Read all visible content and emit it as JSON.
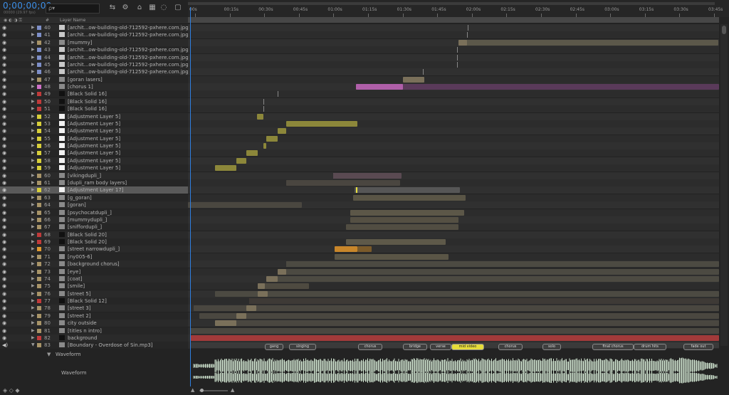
{
  "timecode": "0;00;00;00",
  "fps_label": "00000 (29.97 fps)",
  "search_placeholder": "ρ▾",
  "ruler_ticks": [
    "00s",
    "00:15s",
    "00:30s",
    "00:45s",
    "01:00s",
    "01:15s",
    "01:30s",
    "01:45s",
    "02:00s",
    "02:15s",
    "02:30s",
    "02:45s",
    "03:00s",
    "03:15s",
    "03:30s",
    "03:45s"
  ],
  "header": {
    "hash": "#",
    "layer_name": "Layer Name"
  },
  "colors": {
    "accent": "#3c8fe8",
    "purple": "#b05fa9",
    "olive": "#8c873a",
    "orange": "#c8862a",
    "red": "#a23a3a"
  },
  "layers": [
    {
      "num": "40",
      "name": "[archit...ow-building-old-712592-pxhere.com.jpg]",
      "label": "#7e8fc8",
      "src": "img"
    },
    {
      "num": "41",
      "name": "[archit...ow-building-old-712592-pxhere.com.jpg]",
      "label": "#7e8fc8",
      "src": "img"
    },
    {
      "num": "42",
      "name": "[mummy]",
      "label": "#a89468",
      "src": "comp"
    },
    {
      "num": "43",
      "name": "[archit...ow-building-old-712592-pxhere.com.jpg]",
      "label": "#7e8fc8",
      "src": "img"
    },
    {
      "num": "44",
      "name": "[archit...ow-building-old-712592-pxhere.com.jpg]",
      "label": "#7e8fc8",
      "src": "img"
    },
    {
      "num": "45",
      "name": "[archit...ow-building-old-712592-pxhere.com.jpg]",
      "label": "#7e8fc8",
      "src": "img"
    },
    {
      "num": "46",
      "name": "[archit...ow-building-old-712592-pxhere.com.jpg]",
      "label": "#7e8fc8",
      "src": "img"
    },
    {
      "num": "47",
      "name": "[goran lasers]",
      "label": "#a89468",
      "src": "comp"
    },
    {
      "num": "48",
      "name": "[chorus 1]",
      "label": "#d071c8",
      "src": "comp"
    },
    {
      "num": "49",
      "name": "[Black Solid 16]",
      "label": "#c03a3a",
      "src": "solid"
    },
    {
      "num": "50",
      "name": "[Black Solid 16]",
      "label": "#c03a3a",
      "src": "solid"
    },
    {
      "num": "51",
      "name": "[Black Solid 16]",
      "label": "#c03a3a",
      "src": "solid"
    },
    {
      "num": "52",
      "name": "[Adjustment Layer 5]",
      "label": "#d8cf3a",
      "src": "white"
    },
    {
      "num": "53",
      "name": "[Adjustment Layer 5]",
      "label": "#d8cf3a",
      "src": "white"
    },
    {
      "num": "54",
      "name": "[Adjustment Layer 5]",
      "label": "#d8cf3a",
      "src": "white"
    },
    {
      "num": "55",
      "name": "[Adjustment Layer 5]",
      "label": "#d8cf3a",
      "src": "white"
    },
    {
      "num": "56",
      "name": "[Adjustment Layer 5]",
      "label": "#d8cf3a",
      "src": "white"
    },
    {
      "num": "57",
      "name": "[Adjustment Layer 5]",
      "label": "#d8cf3a",
      "src": "white"
    },
    {
      "num": "58",
      "name": "[Adjustment Layer 5]",
      "label": "#d8cf3a",
      "src": "white"
    },
    {
      "num": "59",
      "name": "[Adjustment Layer 5]",
      "label": "#d8cf3a",
      "src": "white"
    },
    {
      "num": "60",
      "name": "[vikingdupli_]",
      "label": "#a89468",
      "src": "comp"
    },
    {
      "num": "61",
      "name": "[dupli_ram body layers]",
      "label": "#a89468",
      "src": "comp"
    },
    {
      "num": "62",
      "name": "[Adjustment Layer 17]",
      "label": "#d8cf3a",
      "src": "white"
    },
    {
      "num": "63",
      "name": "[g_goran]",
      "label": "#a89468",
      "src": "comp"
    },
    {
      "num": "64",
      "name": "[goran]",
      "label": "#a89468",
      "src": "comp"
    },
    {
      "num": "65",
      "name": "[psychocatdupli_]",
      "label": "#a89468",
      "src": "comp"
    },
    {
      "num": "66",
      "name": "[mummydupli_]",
      "label": "#a89468",
      "src": "comp"
    },
    {
      "num": "67",
      "name": "[sniffordupli_]",
      "label": "#a89468",
      "src": "comp"
    },
    {
      "num": "68",
      "name": "[Black Solid 20]",
      "label": "#c03a3a",
      "src": "solid"
    },
    {
      "num": "69",
      "name": "[Black Solid 20]",
      "label": "#c03a3a",
      "src": "solid"
    },
    {
      "num": "70",
      "name": "[street narrowdupli_]",
      "label": "#e09a30",
      "src": "comp"
    },
    {
      "num": "71",
      "name": "[ny005-6]",
      "label": "#a89468",
      "src": "comp"
    },
    {
      "num": "72",
      "name": "[background chorus]",
      "label": "#a89468",
      "src": "comp"
    },
    {
      "num": "73",
      "name": "[eye]",
      "label": "#a89468",
      "src": "comp"
    },
    {
      "num": "74",
      "name": "[coat]",
      "label": "#a89468",
      "src": "comp"
    },
    {
      "num": "75",
      "name": "[smile]",
      "label": "#a89468",
      "src": "comp"
    },
    {
      "num": "76",
      "name": "[street 5]",
      "label": "#a89468",
      "src": "comp"
    },
    {
      "num": "77",
      "name": "[Black Solid 12]",
      "label": "#c03a3a",
      "src": "solid"
    },
    {
      "num": "78",
      "name": "[street 3]",
      "label": "#a89468",
      "src": "comp"
    },
    {
      "num": "79",
      "name": "[street 2]",
      "label": "#a89468",
      "src": "comp"
    },
    {
      "num": "80",
      "name": "city outside",
      "label": "#a89468",
      "src": "comp"
    },
    {
      "num": "81",
      "name": "[titles n intro]",
      "label": "#a89468",
      "src": "comp"
    },
    {
      "num": "82",
      "name": "background",
      "label": "#c03a3a",
      "src": "solid"
    },
    {
      "num": "83",
      "name": "[Boundary - Overdose of Sin.mp3]",
      "label": "#a89468",
      "src": "audio"
    }
  ],
  "comp_markers": [
    "gang",
    "singing",
    "chorus",
    "bridge",
    "verse",
    "mid video",
    "chorus",
    "solo",
    "final chorus",
    "drum hits",
    "fade out"
  ],
  "waveform_sub": "Waveform",
  "waveform_label": "Waveform"
}
